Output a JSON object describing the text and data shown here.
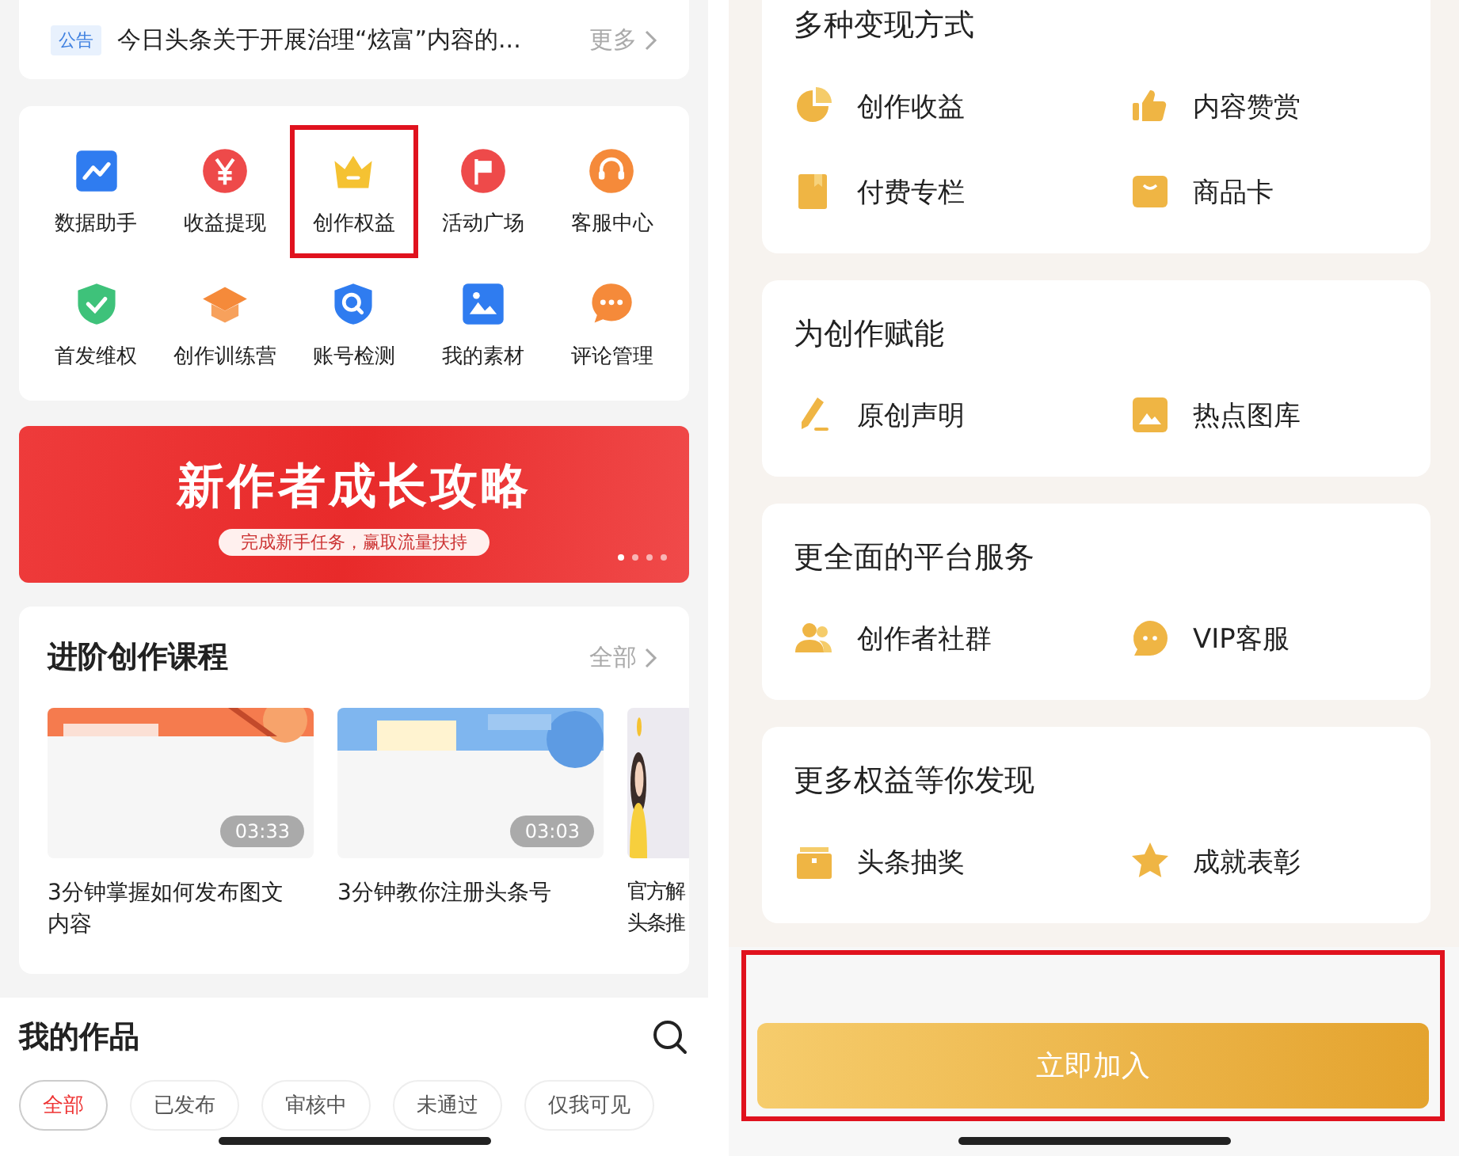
{
  "notice": {
    "tag": "公告",
    "text": "今日头条关于开展治理“炫富”内容的...",
    "more": "更多"
  },
  "tools": [
    {
      "label": "数据助手",
      "highlighted": false
    },
    {
      "label": "收益提现",
      "highlighted": false
    },
    {
      "label": "创作权益",
      "highlighted": true
    },
    {
      "label": "活动广场",
      "highlighted": false
    },
    {
      "label": "客服中心",
      "highlighted": false
    },
    {
      "label": "首发维权",
      "highlighted": false
    },
    {
      "label": "创作训练营",
      "highlighted": false
    },
    {
      "label": "账号检测",
      "highlighted": false
    },
    {
      "label": "我的素材",
      "highlighted": false
    },
    {
      "label": "评论管理",
      "highlighted": false
    }
  ],
  "banner": {
    "title": "新作者成长攻略",
    "subtitle": "完成新手任务，赢取流量扶持",
    "dots": [
      {
        "selected": true
      },
      {
        "selected": false
      },
      {
        "selected": false
      },
      {
        "selected": false
      }
    ]
  },
  "courses": {
    "title": "进阶创作课程",
    "more": "全部",
    "items": [
      {
        "title": "3分钟掌握如何发布图文内容",
        "duration": "03:33"
      },
      {
        "title": "3分钟教你注册头条号",
        "duration": "03:03"
      },
      {
        "title": "官方解头条推"
      }
    ]
  },
  "works": {
    "title": "我的作品",
    "filters": [
      {
        "label": "全部",
        "selected": true
      },
      {
        "label": "已发布",
        "selected": false
      },
      {
        "label": "审核中",
        "selected": false
      },
      {
        "label": "未通过",
        "selected": false
      },
      {
        "label": "仅我可见",
        "selected": false
      }
    ]
  },
  "benefits": [
    {
      "title": "多种变现方式",
      "items": [
        "创作收益",
        "内容赞赏",
        "付费专栏",
        "商品卡"
      ]
    },
    {
      "title": "为创作赋能",
      "items": [
        "原创声明",
        "热点图库"
      ]
    },
    {
      "title": "更全面的平台服务",
      "items": [
        "创作者社群",
        "VIP客服"
      ]
    },
    {
      "title": "更多权益等你发现",
      "items": [
        "头条抽奖",
        "成就表彰"
      ]
    }
  ],
  "join": {
    "label": "立即加入",
    "highlighted": true
  }
}
